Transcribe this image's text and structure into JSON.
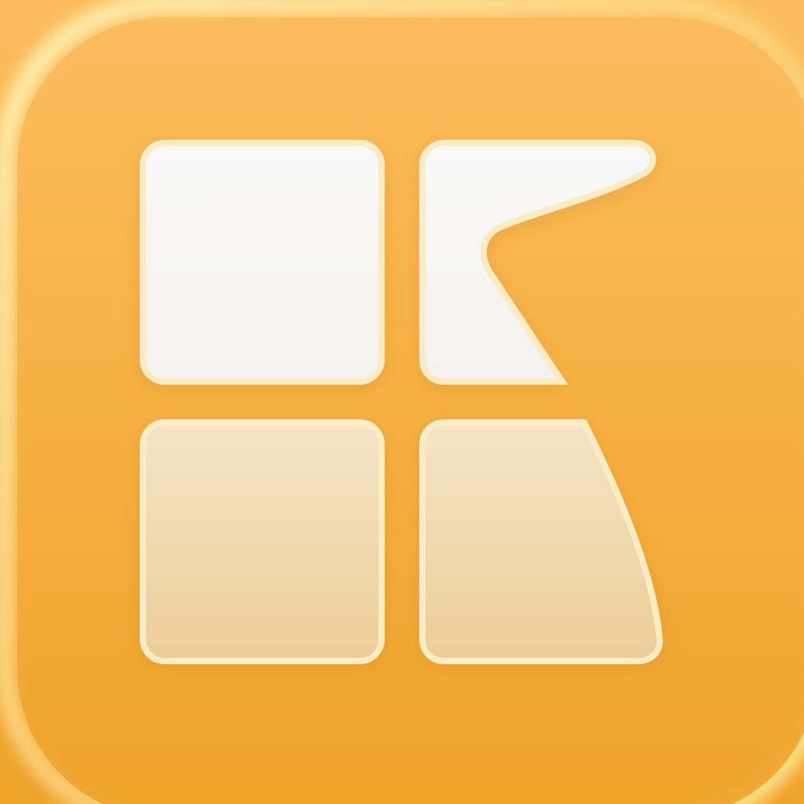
{
  "icon": {
    "name": "app-logo-k-grid",
    "colors": {
      "background_top": "#fcbc5c",
      "background_bottom": "#eea329",
      "rim_highlight": "#fde68f",
      "tile_top": "#f8f8f8",
      "tile_bottom": "#eccd97",
      "tile_border": "#fbecc4"
    }
  }
}
